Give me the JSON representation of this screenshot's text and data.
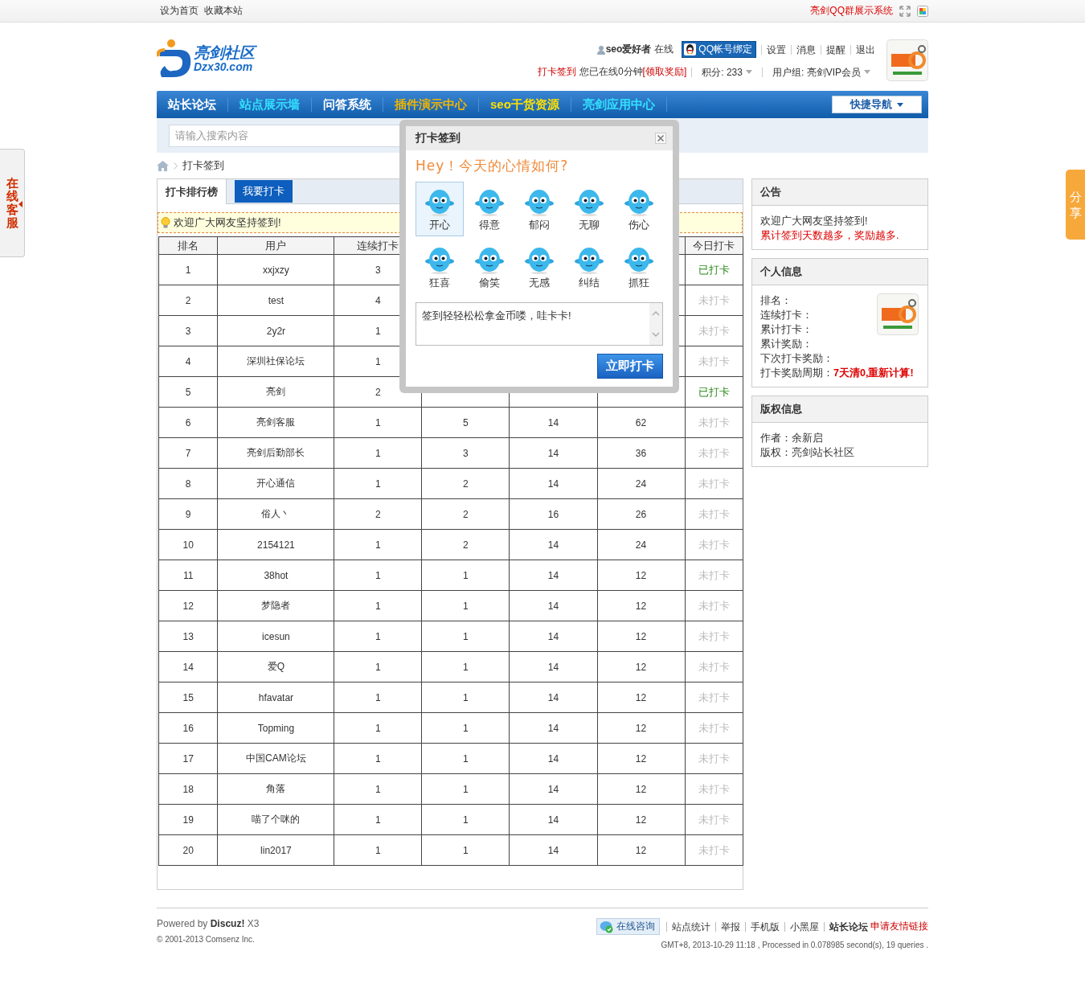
{
  "top_bar": {
    "links": [
      "设为首页",
      "收藏本站"
    ],
    "promo_link": "亮剑QQ群展示系统"
  },
  "header": {
    "logo": {
      "name": "亮剑社区",
      "domain": "Dzx30.com"
    },
    "user": {
      "name": "seo爱好者",
      "status": "在线",
      "qq_bind": "QQ帐号绑定",
      "links": [
        "设置",
        "消息",
        "提醒",
        "退出"
      ],
      "checkin_link": "打卡签到",
      "online_time": "您已在线0分钟",
      "reward_link": "[领取奖励]",
      "points": "积分: 233",
      "group": "用户组: 亮剑VIP会员"
    }
  },
  "nav": {
    "items": [
      {
        "label": "站长论坛",
        "color": "#ffffff"
      },
      {
        "label": "站点展示墙",
        "color": "#33e0ff"
      },
      {
        "label": "问答系统",
        "color": "#ffffff"
      },
      {
        "label": "插件演示中心",
        "color": "#f0b400"
      },
      {
        "label": "seo干货资源",
        "color": "#ffe000"
      },
      {
        "label": "亮剑应用中心",
        "color": "#33e0ff"
      }
    ],
    "quick_nav": "快捷导航"
  },
  "search": {
    "placeholder": "请输入搜索内容"
  },
  "breadcrumb": [
    "打卡签到"
  ],
  "tabs": [
    {
      "label": "打卡排行榜",
      "selected": true
    },
    {
      "label": "我要打卡",
      "selected": false
    }
  ],
  "notice": "欢迎广大网友坚持签到!",
  "table": {
    "columns": [
      "排名",
      "用户",
      "连续打卡",
      null,
      null,
      null,
      "今日打卡"
    ],
    "rows": [
      {
        "rank": "1",
        "user": "xxjxzy",
        "streak": "3",
        "status": "已打卡",
        "signed": true
      },
      {
        "rank": "2",
        "user": "test",
        "streak": "4",
        "status": "未打卡",
        "signed": false
      },
      {
        "rank": "3",
        "user": "2y2r",
        "streak": "1",
        "status": "未打卡",
        "signed": false
      },
      {
        "rank": "4",
        "user": "深圳社保论坛",
        "streak": "1",
        "status": "未打卡",
        "signed": false
      },
      {
        "rank": "5",
        "user": "亮剑",
        "streak": "2",
        "status": "已打卡",
        "signed": true
      },
      {
        "rank": "6",
        "user": "亮剑客服",
        "streak": "1",
        "column_4": "5",
        "column_5": "14",
        "column_6": "62",
        "status": "未打卡",
        "signed": false
      },
      {
        "rank": "7",
        "user": "亮剑后勤部长",
        "streak": "1",
        "column_4": "3",
        "column_5": "14",
        "column_6": "36",
        "status": "未打卡",
        "signed": false
      },
      {
        "rank": "8",
        "user": "开心通信",
        "streak": "1",
        "column_4": "2",
        "column_5": "14",
        "column_6": "24",
        "status": "未打卡",
        "signed": false
      },
      {
        "rank": "9",
        "user": "俗人丶",
        "streak": "2",
        "column_4": "2",
        "column_5": "16",
        "column_6": "26",
        "status": "未打卡",
        "signed": false
      },
      {
        "rank": "10",
        "user": "2154121",
        "streak": "1",
        "column_4": "2",
        "column_5": "14",
        "column_6": "24",
        "status": "未打卡",
        "signed": false
      },
      {
        "rank": "11",
        "user": "38hot",
        "streak": "1",
        "column_4": "1",
        "column_5": "14",
        "column_6": "12",
        "status": "未打卡",
        "signed": false
      },
      {
        "rank": "12",
        "user": "梦隐者",
        "streak": "1",
        "column_4": "1",
        "column_5": "14",
        "column_6": "12",
        "status": "未打卡",
        "signed": false
      },
      {
        "rank": "13",
        "user": "icesun",
        "streak": "1",
        "column_4": "1",
        "column_5": "14",
        "column_6": "12",
        "status": "未打卡",
        "signed": false
      },
      {
        "rank": "14",
        "user": "爱Q",
        "streak": "1",
        "column_4": "1",
        "column_5": "14",
        "column_6": "12",
        "status": "未打卡",
        "signed": false
      },
      {
        "rank": "15",
        "user": "hfavatar",
        "streak": "1",
        "column_4": "1",
        "column_5": "14",
        "column_6": "12",
        "status": "未打卡",
        "signed": false
      },
      {
        "rank": "16",
        "user": "Topming",
        "streak": "1",
        "column_4": "1",
        "column_5": "14",
        "column_6": "12",
        "status": "未打卡",
        "signed": false
      },
      {
        "rank": "17",
        "user": "中国CAM论坛",
        "streak": "1",
        "column_4": "1",
        "column_5": "14",
        "column_6": "12",
        "status": "未打卡",
        "signed": false
      },
      {
        "rank": "18",
        "user": "角落",
        "streak": "1",
        "column_4": "1",
        "column_5": "14",
        "column_6": "12",
        "status": "未打卡",
        "signed": false
      },
      {
        "rank": "19",
        "user": "喵了个咪的",
        "streak": "1",
        "column_4": "1",
        "column_5": "14",
        "column_6": "12",
        "status": "未打卡",
        "signed": false
      },
      {
        "rank": "20",
        "user": "lin2017",
        "streak": "1",
        "column_4": "1",
        "column_5": "14",
        "column_6": "12",
        "status": "未打卡",
        "signed": false
      }
    ]
  },
  "sidebar": {
    "notice": {
      "title": "公告",
      "lines": [
        {
          "text": "欢迎广大网友坚持签到!",
          "highlight": false
        },
        {
          "text": "累计签到天数越多，奖励越多.",
          "highlight": true
        }
      ]
    },
    "profile": {
      "title": "个人信息",
      "fields": [
        {
          "label": "排名："
        },
        {
          "label": "连续打卡："
        },
        {
          "label": "累计打卡："
        },
        {
          "label": "累计奖励："
        },
        {
          "label": "下次打卡奖励："
        },
        {
          "label": "打卡奖励周期：",
          "value": "7天清0,重新计算!"
        }
      ]
    },
    "copyright": {
      "title": "版权信息",
      "lines": [
        "作者：余新启",
        "版权：亮剑站长社区"
      ]
    }
  },
  "footer": {
    "powered": "Powered by **Discuz!** X3",
    "copyright": "© 2001-2013 Comsenz Inc.",
    "consult": "在线咨询",
    "links": [
      "站点统计",
      "举报",
      "手机版",
      "小黑屋"
    ],
    "site_name": "站长论坛",
    "friend_link": "申请友情链接",
    "stats": "GMT+8, 2013-10-29 11:18 , Processed in 0.078985 second(s), 19 queries ."
  },
  "side_tabs": {
    "left": "在线客服",
    "right": "分享"
  },
  "modal": {
    "title": "打卡签到",
    "prompt": "Hey！今天的心情如何?",
    "moods": [
      {
        "label": "开心",
        "selected": true
      },
      {
        "label": "得意",
        "selected": false
      },
      {
        "label": "郁闷",
        "selected": false
      },
      {
        "label": "无聊",
        "selected": false
      },
      {
        "label": "伤心",
        "selected": false
      },
      {
        "label": "狂喜",
        "selected": false
      },
      {
        "label": "偷笑",
        "selected": false
      },
      {
        "label": "无感",
        "selected": false
      },
      {
        "label": "纠结",
        "selected": false
      },
      {
        "label": "抓狂",
        "selected": false
      }
    ],
    "message": "签到轻轻松松拿金币喽，哇卡卡!",
    "submit": "立即打卡"
  }
}
